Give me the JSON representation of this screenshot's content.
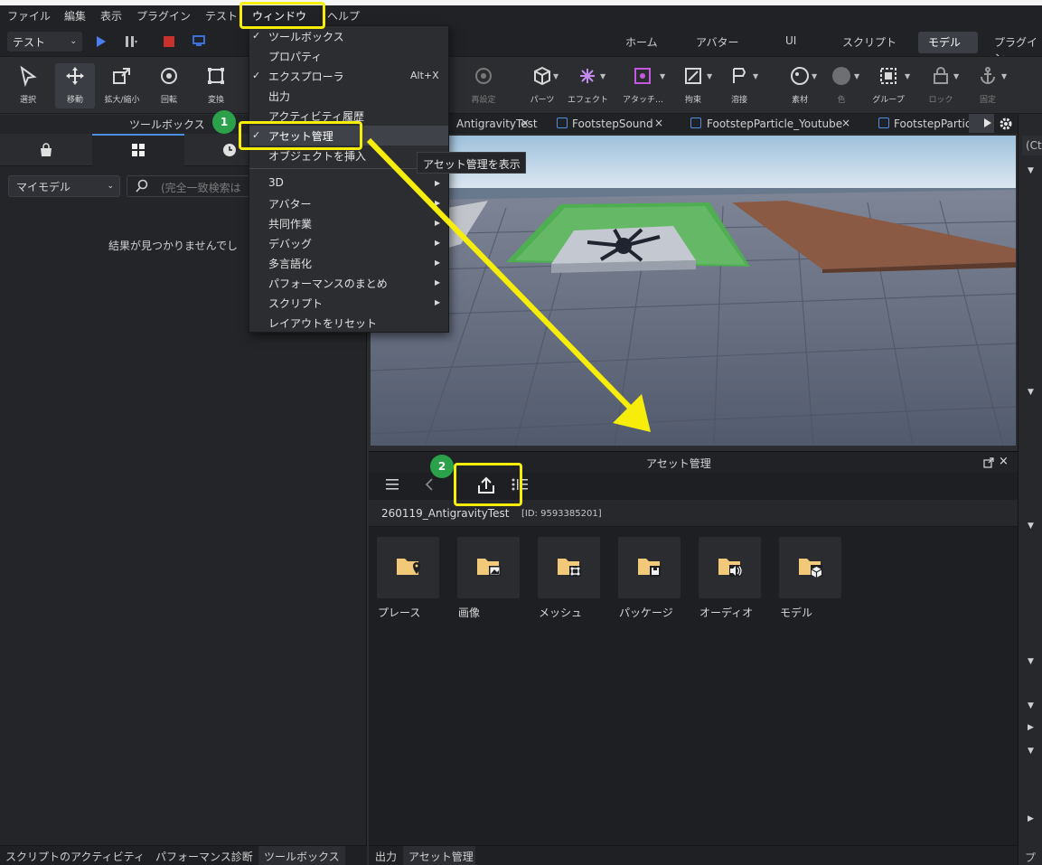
{
  "menubar": {
    "items": [
      "ファイル",
      "編集",
      "表示",
      "プラグイン",
      "テスト",
      "ウィンドウ",
      "ヘルプ"
    ]
  },
  "run": {
    "test_select": "テスト"
  },
  "ribbon_tabs": [
    "ホーム",
    "アバター",
    "UI",
    "スクリプト",
    "モデル",
    "プラグイン"
  ],
  "tools": [
    {
      "label": "選択",
      "icon": "cursor-icon"
    },
    {
      "label": "移動",
      "icon": "move-icon"
    },
    {
      "label": "拡大/縮小",
      "icon": "scale-icon"
    },
    {
      "label": "回転",
      "icon": "rotate-icon"
    },
    {
      "label": "変換",
      "icon": "transform-icon"
    },
    {
      "label": "再設定",
      "icon": "reset-icon"
    },
    {
      "label": "パーツ",
      "icon": "part-icon"
    },
    {
      "label": "エフェクト",
      "icon": "effect-icon"
    },
    {
      "label": "アタッチ…",
      "icon": "attach-icon"
    },
    {
      "label": "拘束",
      "icon": "constraint-icon"
    },
    {
      "label": "溶接",
      "icon": "weld-icon"
    },
    {
      "label": "素材",
      "icon": "material-icon"
    },
    {
      "label": "色",
      "icon": "color-icon"
    },
    {
      "label": "グループ",
      "icon": "group-icon"
    },
    {
      "label": "ロック",
      "icon": "lock-icon"
    },
    {
      "label": "固定",
      "icon": "anchor-icon"
    }
  ],
  "toolbox": {
    "title": "ツールボックス",
    "model_select": "マイモデル",
    "search_placeholder": "(完全一致検索は",
    "empty_message": "結果が見つかりませんでし"
  },
  "window_menu": {
    "items": [
      {
        "label": "ツールボックス",
        "checked": true
      },
      {
        "label": "プロパティ",
        "checked": false
      },
      {
        "label": "エクスプローラ",
        "checked": true,
        "shortcut": "Alt+X"
      },
      {
        "label": "出力",
        "checked": false
      },
      {
        "label": "アクティビティ履歴",
        "checked": false
      },
      {
        "label": "アセット管理",
        "checked": true
      },
      {
        "label": "オブジェクトを挿入",
        "checked": false
      },
      {
        "label": "3D",
        "submenu": true
      },
      {
        "label": "アバター",
        "submenu": true
      },
      {
        "label": "共同作業",
        "submenu": true
      },
      {
        "label": "デバッグ",
        "submenu": true
      },
      {
        "label": "多言語化",
        "submenu": true
      },
      {
        "label": "パフォーマンスのまとめ",
        "submenu": true
      },
      {
        "label": "スクリプト",
        "submenu": true
      },
      {
        "label": "レイアウトをリセット",
        "submenu": false
      }
    ],
    "tooltip": "アセット管理を表示"
  },
  "doc_tabs": [
    {
      "label": "AntigravityTest",
      "close": "×"
    },
    {
      "label": "FootstepSound",
      "close": "×"
    },
    {
      "label": "FootstepParticle_Youtube",
      "close": "×"
    },
    {
      "label": "FootstepPartic",
      "close": ""
    }
  ],
  "asset_manager": {
    "title": "アセット管理",
    "place_name": "260119_AntigravityTest",
    "place_id": "[ID: 9593385201]",
    "folders": [
      {
        "label": "プレース",
        "icon": "folder-place-icon"
      },
      {
        "label": "画像",
        "icon": "folder-image-icon"
      },
      {
        "label": "メッシュ",
        "icon": "folder-mesh-icon"
      },
      {
        "label": "パッケージ",
        "icon": "folder-package-icon"
      },
      {
        "label": "オーディオ",
        "icon": "folder-audio-icon"
      },
      {
        "label": "モデル",
        "icon": "folder-model-icon"
      }
    ]
  },
  "bottom_tabs_left": [
    "スクリプトのアクティビティ",
    "パフォーマンス診断",
    "ツールボックス"
  ],
  "bottom_tabs_mid": [
    "出力",
    "アセット管理"
  ],
  "right_panel": {
    "hint": "(Ct",
    "footer": "プロ"
  },
  "annotations": {
    "badge1": "1",
    "badge2": "2"
  },
  "colors": {
    "highlight": "#f6ee0a",
    "badge": "#2aa14a",
    "accent": "#4a90e2"
  }
}
